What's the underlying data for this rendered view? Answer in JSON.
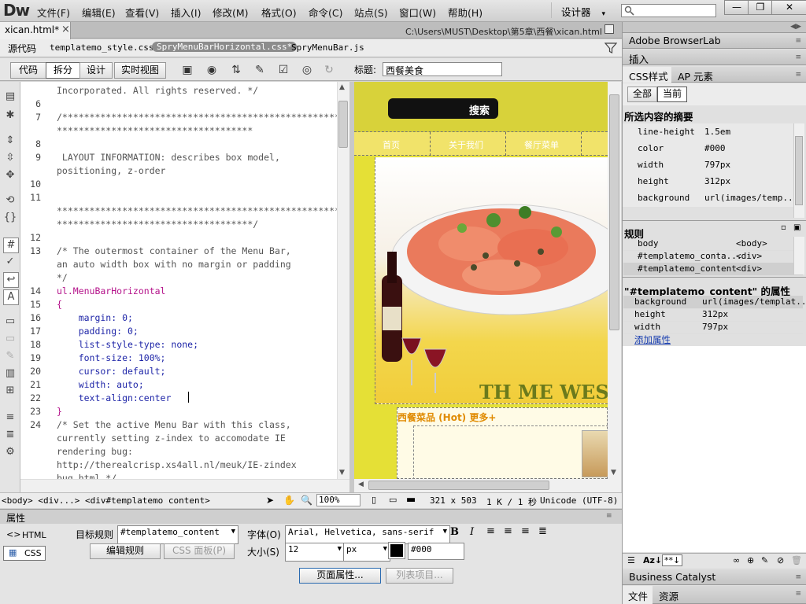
{
  "app": {
    "logo": "Dw",
    "workspace": "设计器",
    "workspace_caret": "▾"
  },
  "menu": [
    "文件(F)",
    "编辑(E)",
    "查看(V)",
    "插入(I)",
    "修改(M)",
    "格式(O)",
    "命令(C)",
    "站点(S)",
    "窗口(W)",
    "帮助(H)"
  ],
  "window_buttons": [
    "—",
    "❐",
    "✕"
  ],
  "document": {
    "tab": "xican.html*",
    "close": "×",
    "path": "C:\\Users\\MUST\\Desktop\\第5章\\西餐\\xican.html"
  },
  "related_files": [
    "源代码",
    "templatemo_style.css",
    "SpryMenuBarHorizontal.css*",
    "SpryMenuBar.js"
  ],
  "view_buttons": [
    "代码",
    "拆分",
    "设计",
    "实时视图"
  ],
  "title_label": "标题:",
  "title_value": "西餐美食",
  "code_lines": [
    {
      "n": "",
      "t": "Incorporated. All rights reserved. */"
    },
    {
      "n": "6",
      "t": ""
    },
    {
      "n": "7",
      "t": "/*****************************************************"
    },
    {
      "n": "",
      "t": "************************************"
    },
    {
      "n": "8",
      "t": ""
    },
    {
      "n": "9",
      "t": " LAYOUT INFORMATION: describes box model,"
    },
    {
      "n": "",
      "t": "positioning, z-order"
    },
    {
      "n": "10",
      "t": ""
    },
    {
      "n": "11",
      "t": ""
    },
    {
      "n": "",
      "t": "*****************************************************"
    },
    {
      "n": "",
      "t": "************************************/"
    },
    {
      "n": "12",
      "t": ""
    },
    {
      "n": "13",
      "t": "/* The outermost container of the Menu Bar,"
    },
    {
      "n": "",
      "t": "an auto width box with no margin or padding"
    },
    {
      "n": "",
      "t": "*/"
    },
    {
      "n": "14",
      "t": "ul.MenuBarHorizontal",
      "c": "sel"
    },
    {
      "n": "15",
      "t": "{",
      "c": "sel"
    },
    {
      "n": "16",
      "t": "    margin: 0;",
      "c": "prop"
    },
    {
      "n": "17",
      "t": "    padding: 0;",
      "c": "prop"
    },
    {
      "n": "18",
      "t": "    list-style-type: none;",
      "c": "prop"
    },
    {
      "n": "19",
      "t": "    font-size: 100%;",
      "c": "prop"
    },
    {
      "n": "20",
      "t": "    cursor: default;",
      "c": "prop"
    },
    {
      "n": "21",
      "t": "    width: auto;",
      "c": "prop"
    },
    {
      "n": "22",
      "t": "    text-align:center",
      "c": "prop"
    },
    {
      "n": "23",
      "t": "}",
      "c": "sel"
    },
    {
      "n": "24",
      "t": "/* Set the active Menu Bar with this class,"
    },
    {
      "n": "",
      "t": "currently setting z-index to accomodate IE"
    },
    {
      "n": "",
      "t": "rendering bug:"
    },
    {
      "n": "",
      "t": "http://therealcrisp.xs4all.nl/meuk/IE-zindex"
    },
    {
      "n": "",
      "t": "bug.html */"
    }
  ],
  "design": {
    "search_button": "搜索",
    "nav": [
      "首页",
      "关于我们",
      "餐厅菜单"
    ],
    "banner_text": "TH ME WEST",
    "section_title": "西餐菜品 (Hot) 更多+"
  },
  "status": {
    "tags": "<body> <div...> <div#templatemo content>",
    "zoom": "100%",
    "size": "321 x 503",
    "weight": "1 K / 1 秒",
    "encoding": "Unicode (UTF-8)"
  },
  "properties": {
    "header": "属性",
    "html_btn": "HTML",
    "css_btn": "CSS",
    "target_rule_label": "目标规则",
    "target_rule_value": "#templatemo_content",
    "edit_rule": "编辑规则",
    "css_panel": "CSS 面板(P)",
    "font_label": "字体(O)",
    "font_value": "Arial, Helvetica, sans-serif",
    "size_label": "大小(S)",
    "size_value": "12",
    "size_unit": "px",
    "color_value": "#000",
    "page_props": "页面属性...",
    "list_items": "列表项目..."
  },
  "right_panel": {
    "browserlab": "Adobe BrowserLab",
    "insert": "插入",
    "tabs": [
      "CSS样式",
      "AP 元素"
    ],
    "mode_buttons": [
      "全部",
      "当前"
    ],
    "summary_title": "所选内容的摘要",
    "summary": [
      {
        "k": "line-height",
        "v": "1.5em"
      },
      {
        "k": "color",
        "v": "#000"
      },
      {
        "k": "width",
        "v": "797px"
      },
      {
        "k": "height",
        "v": "312px"
      },
      {
        "k": "background",
        "v": "url(images/temp..."
      }
    ],
    "rules_title": "规则",
    "rules": [
      {
        "k": "body",
        "v": "<body>"
      },
      {
        "k": "#templatemo_conta...",
        "v": "<div>"
      },
      {
        "k": "#templatemo_content",
        "v": "<div>"
      }
    ],
    "props_title": "\"#templatemo_content\" 的属性",
    "props": [
      {
        "k": "background",
        "v": "url(images/templat..."
      },
      {
        "k": "height",
        "v": "312px"
      },
      {
        "k": "width",
        "v": "797px"
      }
    ],
    "add_property": "添加属性",
    "business_catalyst": "Business Catalyst",
    "bottom_tabs": [
      "文件",
      "资源"
    ]
  }
}
